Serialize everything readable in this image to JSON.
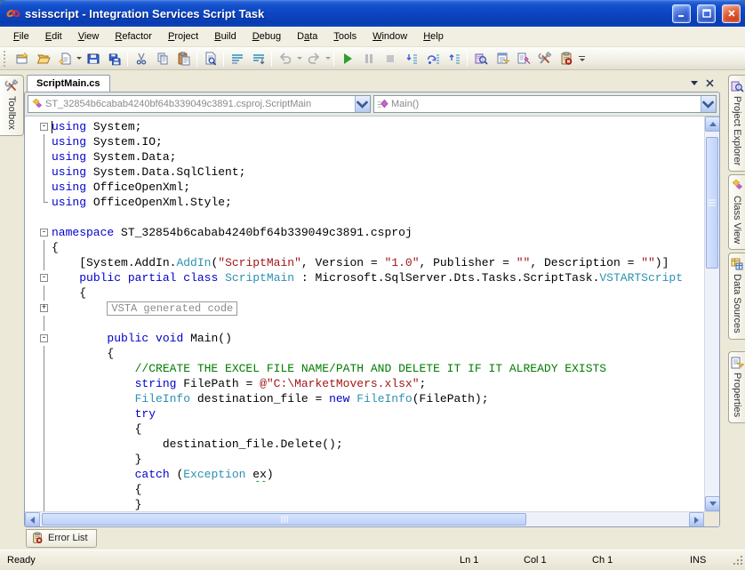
{
  "window": {
    "title": "ssisscript - Integration Services Script Task",
    "controls": [
      "minimize",
      "maximize",
      "close"
    ]
  },
  "menu": {
    "items": [
      {
        "pre": "",
        "u": "F",
        "post": "ile"
      },
      {
        "pre": "",
        "u": "E",
        "post": "dit"
      },
      {
        "pre": "",
        "u": "V",
        "post": "iew"
      },
      {
        "pre": "",
        "u": "R",
        "post": "efactor"
      },
      {
        "pre": "",
        "u": "P",
        "post": "roject"
      },
      {
        "pre": "",
        "u": "B",
        "post": "uild"
      },
      {
        "pre": "",
        "u": "D",
        "post": "ebug"
      },
      {
        "pre": "D",
        "u": "a",
        "post": "ta"
      },
      {
        "pre": "",
        "u": "T",
        "post": "ools"
      },
      {
        "pre": "",
        "u": "W",
        "post": "indow"
      },
      {
        "pre": "",
        "u": "H",
        "post": "elp"
      }
    ]
  },
  "toolbar": {
    "icons": [
      "new-project",
      "open-file",
      "add-item",
      "save",
      "save-all",
      "cut",
      "copy",
      "paste",
      "find-in-files",
      "comment-lines",
      "uncomment-lines",
      "undo",
      "redo",
      "start-debugging",
      "break-all",
      "stop-debugging",
      "step-into",
      "step-over",
      "step-out",
      "project-explorer",
      "properties-window",
      "object-browser",
      "toolbox",
      "error-list",
      "toolbar-options"
    ]
  },
  "document": {
    "tab": "ScriptMain.cs",
    "nav": {
      "class_combo": "ST_32854b6cabab4240bf64b339049c3891.csproj.ScriptMain",
      "method_combo": "Main()"
    }
  },
  "left_tabs": [
    {
      "label": "Toolbox"
    }
  ],
  "right_tabs": [
    {
      "label": "Project Explorer"
    },
    {
      "label": "Class View"
    },
    {
      "label": "Data Sources"
    },
    {
      "label": "Properties"
    }
  ],
  "bottom_tabs": [
    {
      "label": "Error List"
    }
  ],
  "status_bar": {
    "message": "Ready",
    "line": "Ln 1",
    "column": "Col 1",
    "char": "Ch 1",
    "mode": "INS"
  },
  "colors": {
    "titlebar_blue": "#0c44c0",
    "frame_blue": "#0b40bc",
    "client_tan": "#ece9d8",
    "keyword": "#0000cc",
    "type": "#2b91af",
    "string": "#a31515",
    "comment": "#007d00",
    "scrollbar_blue": "#bed1f8",
    "start_green": "#2f9e2f",
    "error_red": "#d43020"
  },
  "editor": {
    "lines": [
      {
        "fold": "minus",
        "seg": [
          [
            "k",
            "using"
          ],
          [
            "p",
            " System;"
          ]
        ]
      },
      {
        "fold": "bar",
        "seg": [
          [
            "k",
            "using"
          ],
          [
            "p",
            " System.IO;"
          ]
        ]
      },
      {
        "fold": "bar",
        "seg": [
          [
            "k",
            "using"
          ],
          [
            "p",
            " System.Data;"
          ]
        ]
      },
      {
        "fold": "bar",
        "seg": [
          [
            "k",
            "using"
          ],
          [
            "p",
            " System.Data.SqlClient;"
          ]
        ]
      },
      {
        "fold": "bar",
        "seg": [
          [
            "k",
            "using"
          ],
          [
            "p",
            " OfficeOpenXml;"
          ]
        ]
      },
      {
        "fold": "corner",
        "seg": [
          [
            "k",
            "using"
          ],
          [
            "p",
            " OfficeOpenXml.Style;"
          ]
        ]
      },
      {
        "fold": "",
        "seg": []
      },
      {
        "fold": "minus",
        "seg": [
          [
            "k",
            "namespace"
          ],
          [
            "p",
            " ST_32854b6cabab4240bf64b339049c3891.csproj"
          ]
        ]
      },
      {
        "fold": "bar",
        "seg": [
          [
            "p",
            "{"
          ]
        ]
      },
      {
        "fold": "bar",
        "seg": [
          [
            "p",
            "    [System.AddIn."
          ],
          [
            "t",
            "AddIn"
          ],
          [
            "p",
            "("
          ],
          [
            "s",
            "\"ScriptMain\""
          ],
          [
            "p",
            ", Version = "
          ],
          [
            "s",
            "\"1.0\""
          ],
          [
            "p",
            ", Publisher = "
          ],
          [
            "s",
            "\"\""
          ],
          [
            "p",
            ", Description = "
          ],
          [
            "s",
            "\"\""
          ],
          [
            "p",
            ")]"
          ]
        ]
      },
      {
        "fold": "minus",
        "seg": [
          [
            "p",
            "    "
          ],
          [
            "k",
            "public"
          ],
          [
            "p",
            " "
          ],
          [
            "k",
            "partial"
          ],
          [
            "p",
            " "
          ],
          [
            "k",
            "class"
          ],
          [
            "p",
            " "
          ],
          [
            "t",
            "ScriptMain"
          ],
          [
            "p",
            " : Microsoft.SqlServer.Dts.Tasks.ScriptTask."
          ],
          [
            "t",
            "VSTARTScript"
          ]
        ]
      },
      {
        "fold": "bar",
        "seg": [
          [
            "p",
            "    {"
          ]
        ]
      },
      {
        "fold": "plus",
        "box": "VSTA generated code",
        "indent": 8
      },
      {
        "fold": "bar",
        "seg": []
      },
      {
        "fold": "minus",
        "seg": [
          [
            "p",
            "        "
          ],
          [
            "k",
            "public"
          ],
          [
            "p",
            " "
          ],
          [
            "k",
            "void"
          ],
          [
            "p",
            " Main()"
          ]
        ]
      },
      {
        "fold": "bar",
        "seg": [
          [
            "p",
            "        {"
          ]
        ]
      },
      {
        "fold": "bar",
        "seg": [
          [
            "c",
            "            //CREATE THE EXCEL FILE NAME/PATH AND DELETE IT IF IT ALREADY EXISTS"
          ]
        ]
      },
      {
        "fold": "bar",
        "seg": [
          [
            "p",
            "            "
          ],
          [
            "k",
            "string"
          ],
          [
            "p",
            " FilePath = "
          ],
          [
            "s",
            "@\"C:\\MarketMovers.xlsx\""
          ],
          [
            "p",
            ";"
          ]
        ]
      },
      {
        "fold": "bar",
        "seg": [
          [
            "p",
            "            "
          ],
          [
            "t",
            "FileInfo"
          ],
          [
            "p",
            " destination_file = "
          ],
          [
            "k",
            "new"
          ],
          [
            "p",
            " "
          ],
          [
            "t",
            "FileInfo"
          ],
          [
            "p",
            "(FilePath);"
          ]
        ]
      },
      {
        "fold": "bar",
        "seg": [
          [
            "p",
            "            "
          ],
          [
            "k",
            "try"
          ]
        ]
      },
      {
        "fold": "bar",
        "seg": [
          [
            "p",
            "            {"
          ]
        ]
      },
      {
        "fold": "bar",
        "seg": [
          [
            "p",
            "                destination_file.Delete();"
          ]
        ]
      },
      {
        "fold": "bar",
        "seg": [
          [
            "p",
            "            }"
          ]
        ]
      },
      {
        "fold": "bar",
        "seg": [
          [
            "p",
            "            "
          ],
          [
            "k",
            "catch"
          ],
          [
            "p",
            " ("
          ],
          [
            "t",
            "Exception"
          ],
          [
            "p",
            " "
          ],
          [
            "w",
            "ex"
          ],
          [
            "p",
            ")"
          ]
        ]
      },
      {
        "fold": "bar",
        "seg": [
          [
            "p",
            "            {"
          ]
        ]
      },
      {
        "fold": "bar",
        "seg": [
          [
            "p",
            "            }"
          ]
        ]
      }
    ]
  }
}
